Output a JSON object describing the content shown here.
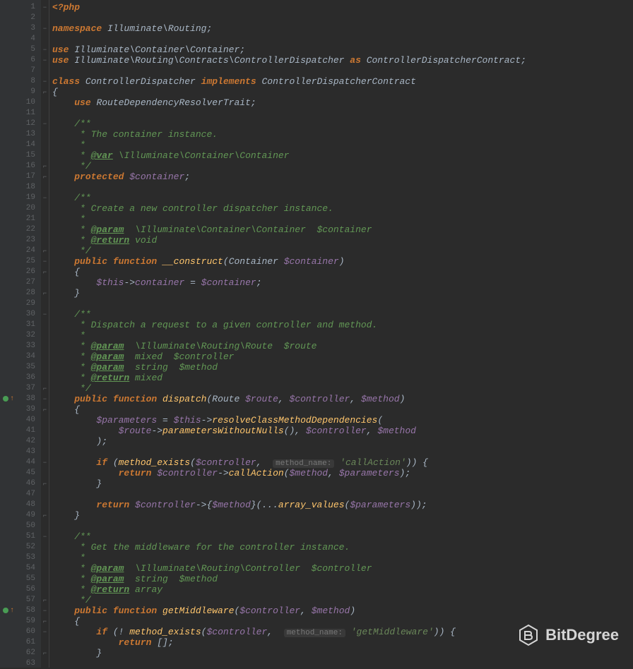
{
  "watermark": "BitDegree",
  "total_lines": 63,
  "marked_lines": [
    38,
    58
  ],
  "fold_marks": {
    "1": "−",
    "3": "−",
    "5": "−",
    "6": "−",
    "8": "−",
    "9": "⌐",
    "12": "−",
    "16": "⌐",
    "17": "⌐",
    "19": "−",
    "24": "⌐",
    "25": "−",
    "26": "⌐",
    "28": "⌐",
    "30": "−",
    "37": "⌐",
    "38": "−",
    "39": "⌐",
    "44": "−",
    "46": "⌐",
    "49": "⌐",
    "51": "−",
    "57": "⌐",
    "58": "−",
    "59": "⌐",
    "60": "−",
    "62": "⌐"
  },
  "code": [
    [
      [
        "k",
        "<?php"
      ]
    ],
    [],
    [
      [
        "k",
        "namespace "
      ],
      [
        "cls",
        "Illuminate\\Routing"
      ],
      [
        "p",
        ";"
      ]
    ],
    [],
    [
      [
        "k",
        "use "
      ],
      [
        "cls",
        "Illuminate\\Container\\Container"
      ],
      [
        "p",
        ";"
      ]
    ],
    [
      [
        "k",
        "use "
      ],
      [
        "cls",
        "Illuminate\\Routing\\Contracts\\ControllerDispatcher "
      ],
      [
        "k",
        "as "
      ],
      [
        "cls",
        "ControllerDispatcherContract"
      ],
      [
        "p",
        ";"
      ]
    ],
    [],
    [
      [
        "k",
        "class "
      ],
      [
        "cls",
        "ControllerDispatcher "
      ],
      [
        "k",
        "implements "
      ],
      [
        "cls",
        "ControllerDispatcherContract"
      ]
    ],
    [
      [
        "p",
        "{"
      ]
    ],
    [
      [
        "p",
        "    "
      ],
      [
        "k",
        "use "
      ],
      [
        "cls",
        "RouteDependencyResolverTrait"
      ],
      [
        "p",
        ";"
      ]
    ],
    [],
    [
      [
        "p",
        "    "
      ],
      [
        "doc",
        "/**"
      ]
    ],
    [
      [
        "p",
        "    "
      ],
      [
        "doc",
        " * The container instance."
      ]
    ],
    [
      [
        "p",
        "    "
      ],
      [
        "doc",
        " *"
      ]
    ],
    [
      [
        "p",
        "    "
      ],
      [
        "doc",
        " * "
      ],
      [
        "tag",
        "@var"
      ],
      [
        "doc",
        " \\Illuminate\\Container\\Container"
      ]
    ],
    [
      [
        "p",
        "    "
      ],
      [
        "doc",
        " */"
      ]
    ],
    [
      [
        "p",
        "    "
      ],
      [
        "k",
        "protected "
      ],
      [
        "var",
        "$container"
      ],
      [
        "p",
        ";"
      ]
    ],
    [],
    [
      [
        "p",
        "    "
      ],
      [
        "doc",
        "/**"
      ]
    ],
    [
      [
        "p",
        "    "
      ],
      [
        "doc",
        " * Create a new controller dispatcher instance."
      ]
    ],
    [
      [
        "p",
        "    "
      ],
      [
        "doc",
        " *"
      ]
    ],
    [
      [
        "p",
        "    "
      ],
      [
        "doc",
        " * "
      ],
      [
        "tag",
        "@param"
      ],
      [
        "doc",
        "  \\Illuminate\\Container\\Container  $container"
      ]
    ],
    [
      [
        "p",
        "    "
      ],
      [
        "doc",
        " * "
      ],
      [
        "tag",
        "@return"
      ],
      [
        "doc",
        " void"
      ]
    ],
    [
      [
        "p",
        "    "
      ],
      [
        "doc",
        " */"
      ]
    ],
    [
      [
        "p",
        "    "
      ],
      [
        "k",
        "public function "
      ],
      [
        "fn",
        "__construct"
      ],
      [
        "p",
        "("
      ],
      [
        "cls",
        "Container "
      ],
      [
        "var",
        "$container"
      ],
      [
        "p",
        ")"
      ]
    ],
    [
      [
        "p",
        "    {"
      ]
    ],
    [
      [
        "p",
        "        "
      ],
      [
        "var",
        "$this"
      ],
      [
        "p",
        "->"
      ],
      [
        "var",
        "container"
      ],
      [
        "p",
        " = "
      ],
      [
        "var",
        "$container"
      ],
      [
        "p",
        ";"
      ]
    ],
    [
      [
        "p",
        "    }"
      ]
    ],
    [],
    [
      [
        "p",
        "    "
      ],
      [
        "doc",
        "/**"
      ]
    ],
    [
      [
        "p",
        "    "
      ],
      [
        "doc",
        " * Dispatch a request to a given controller and method."
      ]
    ],
    [
      [
        "p",
        "    "
      ],
      [
        "doc",
        " *"
      ]
    ],
    [
      [
        "p",
        "    "
      ],
      [
        "doc",
        " * "
      ],
      [
        "tag",
        "@param"
      ],
      [
        "doc",
        "  \\Illuminate\\Routing\\Route  $route"
      ]
    ],
    [
      [
        "p",
        "    "
      ],
      [
        "doc",
        " * "
      ],
      [
        "tag",
        "@param"
      ],
      [
        "doc",
        "  mixed  $controller"
      ]
    ],
    [
      [
        "p",
        "    "
      ],
      [
        "doc",
        " * "
      ],
      [
        "tag",
        "@param"
      ],
      [
        "doc",
        "  string  $method"
      ]
    ],
    [
      [
        "p",
        "    "
      ],
      [
        "doc",
        " * "
      ],
      [
        "tag",
        "@return"
      ],
      [
        "doc",
        " mixed"
      ]
    ],
    [
      [
        "p",
        "    "
      ],
      [
        "doc",
        " */"
      ]
    ],
    [
      [
        "p",
        "    "
      ],
      [
        "k",
        "public function "
      ],
      [
        "fn",
        "dispatch"
      ],
      [
        "p",
        "("
      ],
      [
        "cls",
        "Route "
      ],
      [
        "var",
        "$route"
      ],
      [
        "p",
        ", "
      ],
      [
        "var",
        "$controller"
      ],
      [
        "p",
        ", "
      ],
      [
        "var",
        "$method"
      ],
      [
        "p",
        ")"
      ]
    ],
    [
      [
        "p",
        "    {"
      ]
    ],
    [
      [
        "p",
        "        "
      ],
      [
        "var",
        "$parameters"
      ],
      [
        "p",
        " = "
      ],
      [
        "var",
        "$this"
      ],
      [
        "p",
        "->"
      ],
      [
        "fn",
        "resolveClassMethodDependencies"
      ],
      [
        "p",
        "("
      ]
    ],
    [
      [
        "p",
        "            "
      ],
      [
        "var",
        "$route"
      ],
      [
        "p",
        "->"
      ],
      [
        "fn",
        "parametersWithoutNulls"
      ],
      [
        "p",
        "(), "
      ],
      [
        "var",
        "$controller"
      ],
      [
        "p",
        ", "
      ],
      [
        "var",
        "$method"
      ]
    ],
    [
      [
        "p",
        "        );"
      ]
    ],
    [],
    [
      [
        "p",
        "        "
      ],
      [
        "k",
        "if "
      ],
      [
        "p",
        "("
      ],
      [
        "fn",
        "method_exists"
      ],
      [
        "p",
        "("
      ],
      [
        "var",
        "$controller"
      ],
      [
        "p",
        ",  "
      ],
      [
        "hint",
        "method_name:"
      ],
      [
        "p",
        " "
      ],
      [
        "s",
        "'callAction'"
      ],
      [
        "p",
        ")) {"
      ]
    ],
    [
      [
        "p",
        "            "
      ],
      [
        "k",
        "return "
      ],
      [
        "var",
        "$controller"
      ],
      [
        "p",
        "->"
      ],
      [
        "fn",
        "callAction"
      ],
      [
        "p",
        "("
      ],
      [
        "var",
        "$method"
      ],
      [
        "p",
        ", "
      ],
      [
        "var",
        "$parameters"
      ],
      [
        "p",
        ");"
      ]
    ],
    [
      [
        "p",
        "        }"
      ]
    ],
    [],
    [
      [
        "p",
        "        "
      ],
      [
        "k",
        "return "
      ],
      [
        "var",
        "$controller"
      ],
      [
        "p",
        "->{"
      ],
      [
        "var",
        "$method"
      ],
      [
        "p",
        "}(..."
      ],
      [
        "fn",
        "array_values"
      ],
      [
        "p",
        "("
      ],
      [
        "var",
        "$parameters"
      ],
      [
        "p",
        "));"
      ]
    ],
    [
      [
        "p",
        "    }"
      ]
    ],
    [],
    [
      [
        "p",
        "    "
      ],
      [
        "doc",
        "/**"
      ]
    ],
    [
      [
        "p",
        "    "
      ],
      [
        "doc",
        " * Get the middleware for the controller instance."
      ]
    ],
    [
      [
        "p",
        "    "
      ],
      [
        "doc",
        " *"
      ]
    ],
    [
      [
        "p",
        "    "
      ],
      [
        "doc",
        " * "
      ],
      [
        "tag",
        "@param"
      ],
      [
        "doc",
        "  \\Illuminate\\Routing\\Controller  $controller"
      ]
    ],
    [
      [
        "p",
        "    "
      ],
      [
        "doc",
        " * "
      ],
      [
        "tag",
        "@param"
      ],
      [
        "doc",
        "  string  $method"
      ]
    ],
    [
      [
        "p",
        "    "
      ],
      [
        "doc",
        " * "
      ],
      [
        "tag",
        "@return"
      ],
      [
        "doc",
        " array"
      ]
    ],
    [
      [
        "p",
        "    "
      ],
      [
        "doc",
        " */"
      ]
    ],
    [
      [
        "p",
        "    "
      ],
      [
        "k",
        "public function "
      ],
      [
        "fn",
        "getMiddleware"
      ],
      [
        "p",
        "("
      ],
      [
        "var",
        "$controller"
      ],
      [
        "p",
        ", "
      ],
      [
        "var",
        "$method"
      ],
      [
        "p",
        ")"
      ]
    ],
    [
      [
        "p",
        "    {"
      ]
    ],
    [
      [
        "p",
        "        "
      ],
      [
        "k",
        "if "
      ],
      [
        "p",
        "(! "
      ],
      [
        "fn",
        "method_exists"
      ],
      [
        "p",
        "("
      ],
      [
        "var",
        "$controller"
      ],
      [
        "p",
        ",  "
      ],
      [
        "hint",
        "method_name:"
      ],
      [
        "p",
        " "
      ],
      [
        "s",
        "'getMiddleware'"
      ],
      [
        "p",
        ")) {"
      ]
    ],
    [
      [
        "p",
        "            "
      ],
      [
        "k",
        "return "
      ],
      [
        "p",
        "[];"
      ]
    ],
    [
      [
        "p",
        "        }"
      ]
    ],
    []
  ]
}
